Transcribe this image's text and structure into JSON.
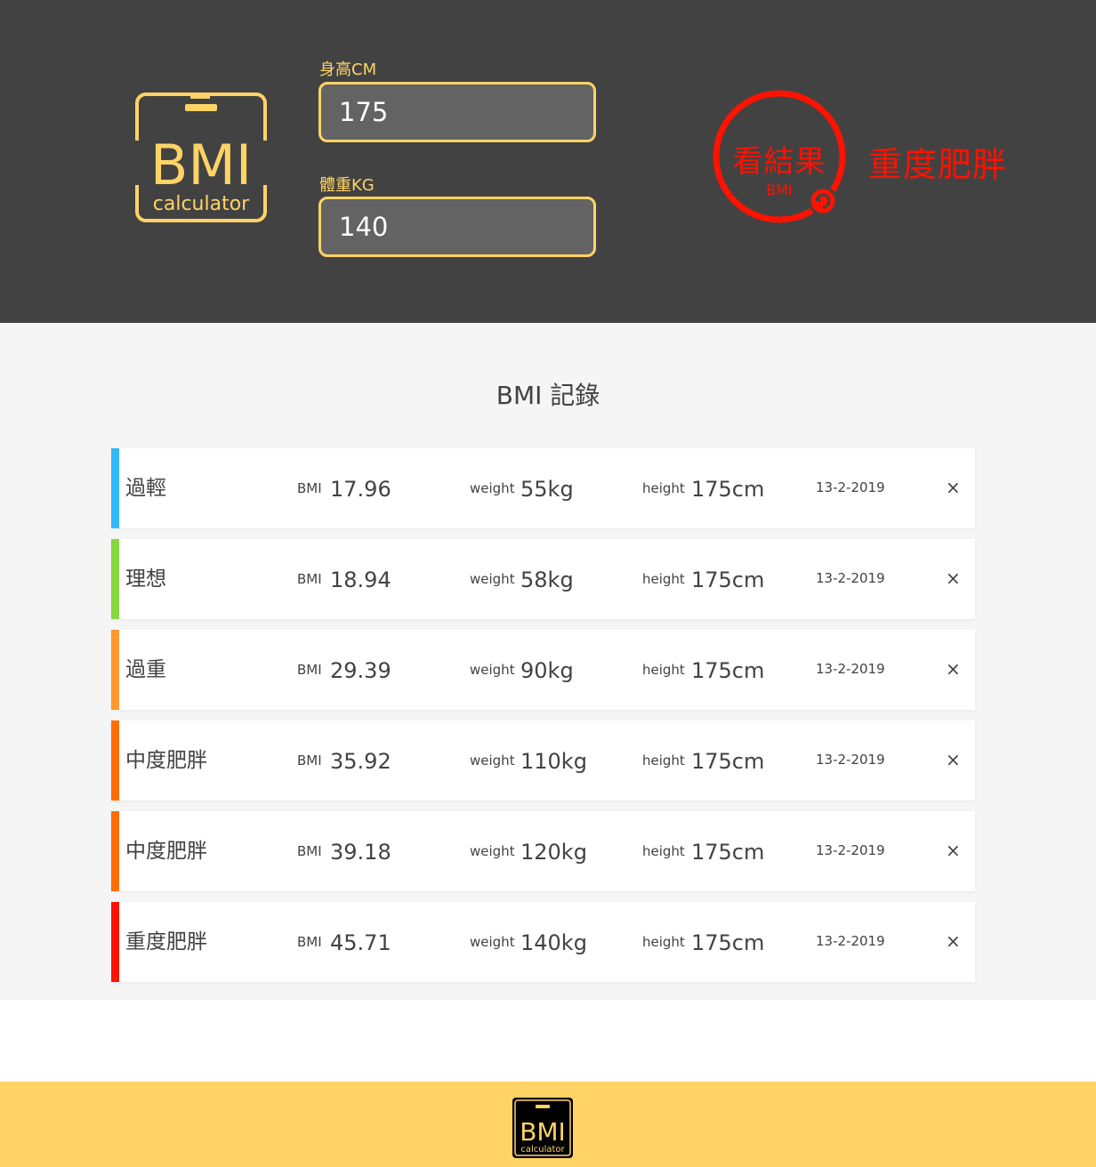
{
  "header": {
    "logo": {
      "main_text": "BMI",
      "sub_text": "calculator"
    },
    "height_field": {
      "label": "身高CM",
      "value": "175"
    },
    "weight_field": {
      "label": "體重KG",
      "value": "140"
    },
    "result": {
      "button_text": "看結果",
      "button_sub": "BMI",
      "status": "重度肥胖",
      "color": "#ff1200"
    }
  },
  "records": {
    "title": "BMI 記錄",
    "bmi_label": "BMI",
    "weight_label": "weight",
    "height_label": "height",
    "delete_symbol": "×",
    "items": [
      {
        "status": "過輕",
        "bmi": "17.96",
        "weight": "55kg",
        "height": "175cm",
        "date": "13-2-2019",
        "color": "#31baf9"
      },
      {
        "status": "理想",
        "bmi": "18.94",
        "weight": "58kg",
        "height": "175cm",
        "date": "13-2-2019",
        "color": "#86d73e"
      },
      {
        "status": "過重",
        "bmi": "29.39",
        "weight": "90kg",
        "height": "175cm",
        "date": "13-2-2019",
        "color": "#ff982d"
      },
      {
        "status": "中度肥胖",
        "bmi": "35.92",
        "weight": "110kg",
        "height": "175cm",
        "date": "13-2-2019",
        "color": "#ff6c02"
      },
      {
        "status": "中度肥胖",
        "bmi": "39.18",
        "weight": "120kg",
        "height": "175cm",
        "date": "13-2-2019",
        "color": "#ff6c02"
      },
      {
        "status": "重度肥胖",
        "bmi": "45.71",
        "weight": "140kg",
        "height": "175cm",
        "date": "13-2-2019",
        "color": "#ff1200"
      }
    ]
  },
  "footer": {
    "logo": {
      "main_text": "BMI",
      "sub_text": "calculator"
    }
  },
  "colors": {
    "header_bg": "#424242",
    "accent": "#ffd366",
    "records_bg": "#f5f5f5",
    "text": "#424242"
  }
}
